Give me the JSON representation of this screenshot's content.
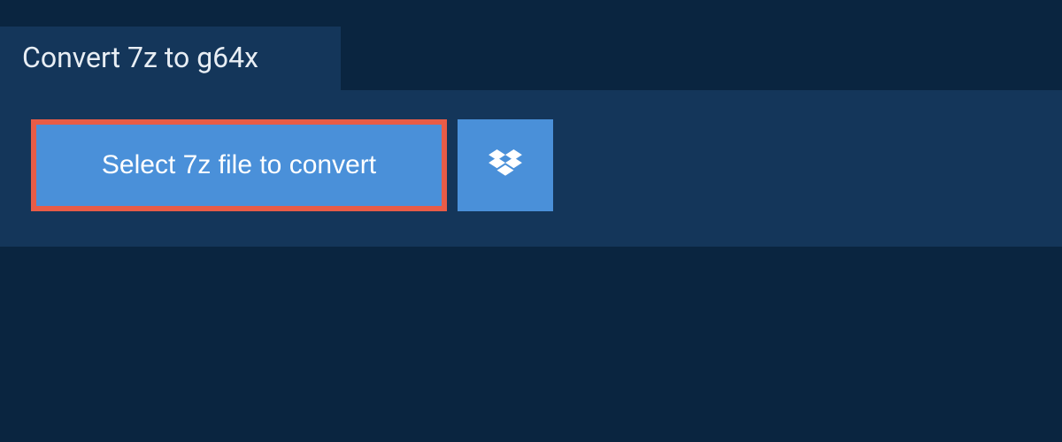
{
  "header": {
    "tab_label": "Convert 7z to g64x"
  },
  "main": {
    "select_button_label": "Select 7z file to convert",
    "dropbox_icon_name": "dropbox-icon"
  },
  "colors": {
    "page_bg": "#0a2540",
    "panel_bg": "#14365a",
    "button_bg": "#4a90d9",
    "button_border": "#e85c47",
    "text_light": "#e8eef4",
    "text_white": "#ffffff"
  }
}
